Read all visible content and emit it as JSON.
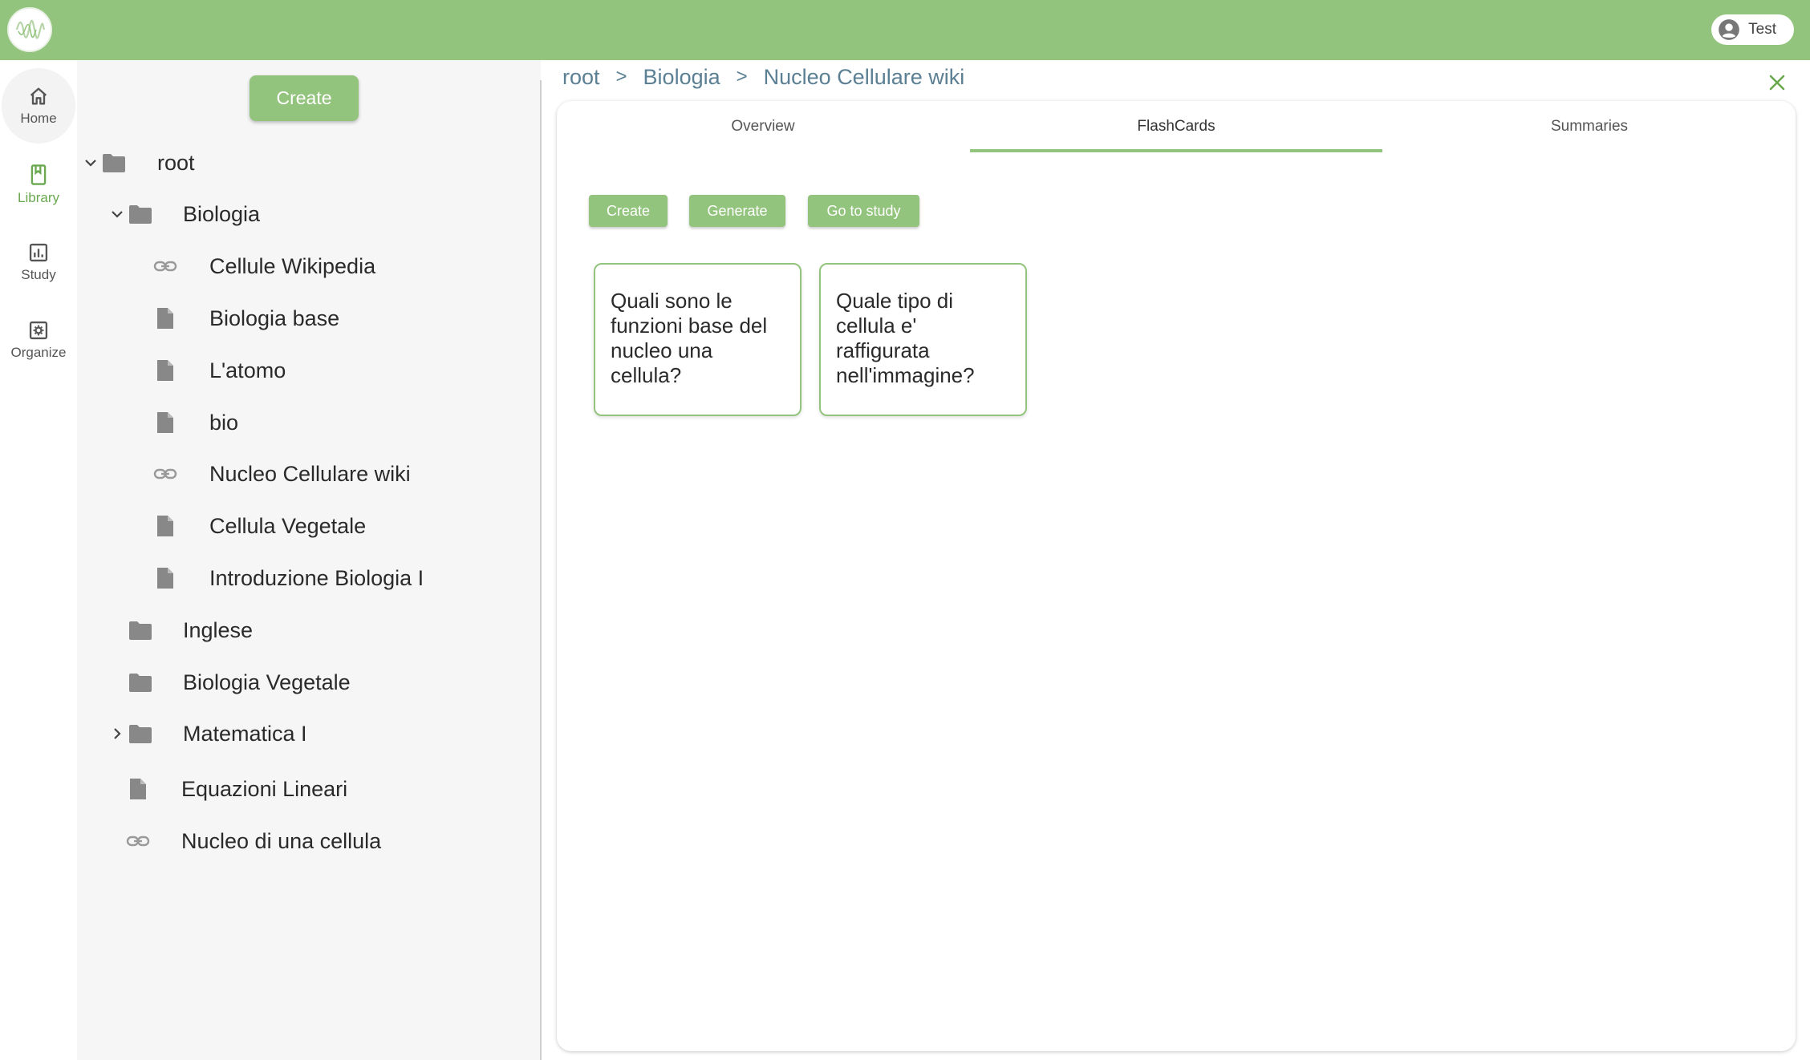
{
  "user": {
    "name": "Test",
    "icon": "account-circle-icon"
  },
  "nav": [
    {
      "label": "Home",
      "icon": "home-icon"
    },
    {
      "label": "Library",
      "icon": "bookmark-icon",
      "active": true
    },
    {
      "label": "Study",
      "icon": "bar-chart-icon"
    },
    {
      "label": "Organize",
      "icon": "settings-box-icon"
    }
  ],
  "tree": {
    "create_label": "Create",
    "items": [
      {
        "label": "root",
        "type": "folder",
        "expanded": true
      },
      {
        "label": "Biologia",
        "type": "folder",
        "expanded": true
      },
      {
        "label": "Cellule Wikipedia",
        "type": "link"
      },
      {
        "label": "Biologia base",
        "type": "file"
      },
      {
        "label": "L'atomo",
        "type": "file"
      },
      {
        "label": "bio",
        "type": "file"
      },
      {
        "label": "Nucleo Cellulare wiki",
        "type": "link"
      },
      {
        "label": "Cellula Vegetale",
        "type": "file"
      },
      {
        "label": "Introduzione Biologia I",
        "type": "file"
      },
      {
        "label": "Inglese",
        "type": "folder"
      },
      {
        "label": "Biologia Vegetale",
        "type": "folder"
      },
      {
        "label": "Matematica I",
        "type": "folder",
        "expanded": false
      },
      {
        "label": "Equazioni Lineari",
        "type": "file"
      },
      {
        "label": "Nucleo di una cellula",
        "type": "link"
      }
    ]
  },
  "breadcrumb": {
    "items": [
      "root",
      "Biologia",
      "Nucleo Cellulare wiki"
    ],
    "separator": ">"
  },
  "tabs": [
    {
      "label": "Overview"
    },
    {
      "label": "FlashCards",
      "active": true
    },
    {
      "label": "Summaries"
    }
  ],
  "actions": {
    "create": "Create",
    "generate": "Generate",
    "study": "Go to study"
  },
  "flashcards": [
    {
      "question": "Quali sono le funzioni base del nucleo una cellula?"
    },
    {
      "question": "Quale tipo di cellula e' raffigurata nell'immagine?"
    }
  ],
  "colors": {
    "accent": "#93c47d",
    "breadcrumb": "#5b7f93",
    "panel": "#f6f6f6"
  }
}
